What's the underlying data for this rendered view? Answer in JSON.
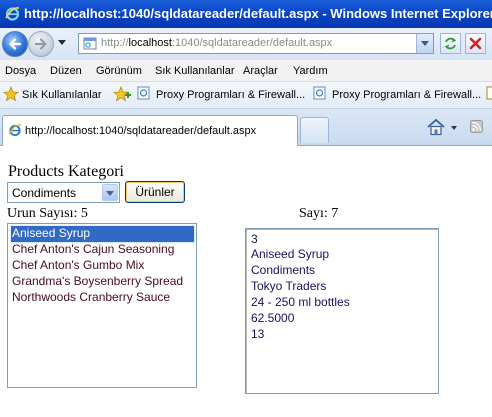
{
  "window": {
    "title": "http://localhost:1040/sqldatareader/default.aspx - Windows Internet Explorer"
  },
  "address": {
    "prefix": "http://",
    "host": "localhost",
    "rest": ":1040/sqldatareader/default.aspx"
  },
  "menu": [
    "Dosya",
    "Düzen",
    "Görünüm",
    "Sık Kullanılanlar",
    "Araçlar",
    "Yardım"
  ],
  "favorites": {
    "main": "Sık Kullanılanlar",
    "items": [
      "Proxy Programları & Firewall...",
      "Proxy Programları & Firewall..."
    ]
  },
  "tab": {
    "label": "http://localhost:1040/sqldatareader/default.aspx"
  },
  "page": {
    "heading": "Products Kategori",
    "select_value": "Condiments",
    "button_label": "Ürünler",
    "count_label": "Urun Sayısı: 5",
    "sayi_label": "Sayı: 7",
    "products": [
      "Aniseed Syrup",
      "Chef Anton's Cajun Seasoning",
      "Chef Anton's Gumbo Mix",
      "Grandma's Boysenberry Spread",
      "Northwoods Cranberry Sauce"
    ],
    "selected_index": 0,
    "details": [
      "3",
      "Aniseed Syrup",
      "Condiments",
      "Tokyo Traders",
      "24 - 250 ml bottles",
      "62.5000",
      "13"
    ]
  },
  "colors": {
    "titlebar": "#0a46c8",
    "selection": "#316ac5",
    "list_text": "#4a0a20",
    "detail_text": "#1a1060"
  },
  "icons": [
    "ie-logo-icon",
    "back-arrow-icon",
    "forward-arrow-icon",
    "page-icon",
    "refresh-icon",
    "stop-icon",
    "favorites-star-icon",
    "add-favorites-icon",
    "home-icon",
    "rss-icon"
  ]
}
